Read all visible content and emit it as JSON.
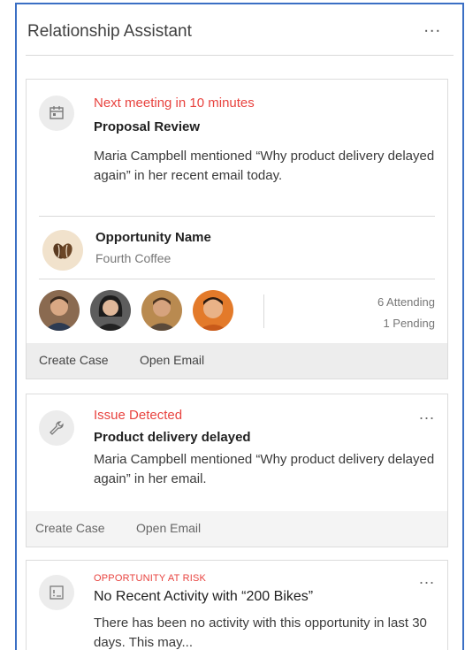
{
  "panel": {
    "title": "Relationship Assistant",
    "more": "..."
  },
  "card1": {
    "status": "Next meeting in 10 minutes",
    "title": "Proposal Review",
    "description": "Maria Campbell mentioned “Why product delivery delayed again” in her recent email today.",
    "opportunity": {
      "name": "Opportunity Name",
      "account": "Fourth Coffee"
    },
    "attending": "6 Attending",
    "pending": "1 Pending",
    "actions": [
      "Create Case",
      "Open Email"
    ]
  },
  "card2": {
    "status": "Issue Detected",
    "title": "Product delivery delayed",
    "description": "Maria Campbell mentioned “Why product delivery delayed again” in her email.",
    "more": "...",
    "actions": [
      "Create Case",
      "Open Email"
    ]
  },
  "card3": {
    "status": "OPPORTUNITY AT RISK",
    "title": "No Recent Activity with “200 Bikes”",
    "description": "There has been no activity with this opportunity in last 30 days. This may...",
    "more": "..."
  },
  "colors": {
    "alert": "#e8433f",
    "frame": "#3b6fc4",
    "action_bar": "#ededed"
  },
  "icons": [
    "meeting-icon",
    "coffee-beans-icon",
    "wrench-icon",
    "opportunity-risk-icon"
  ]
}
